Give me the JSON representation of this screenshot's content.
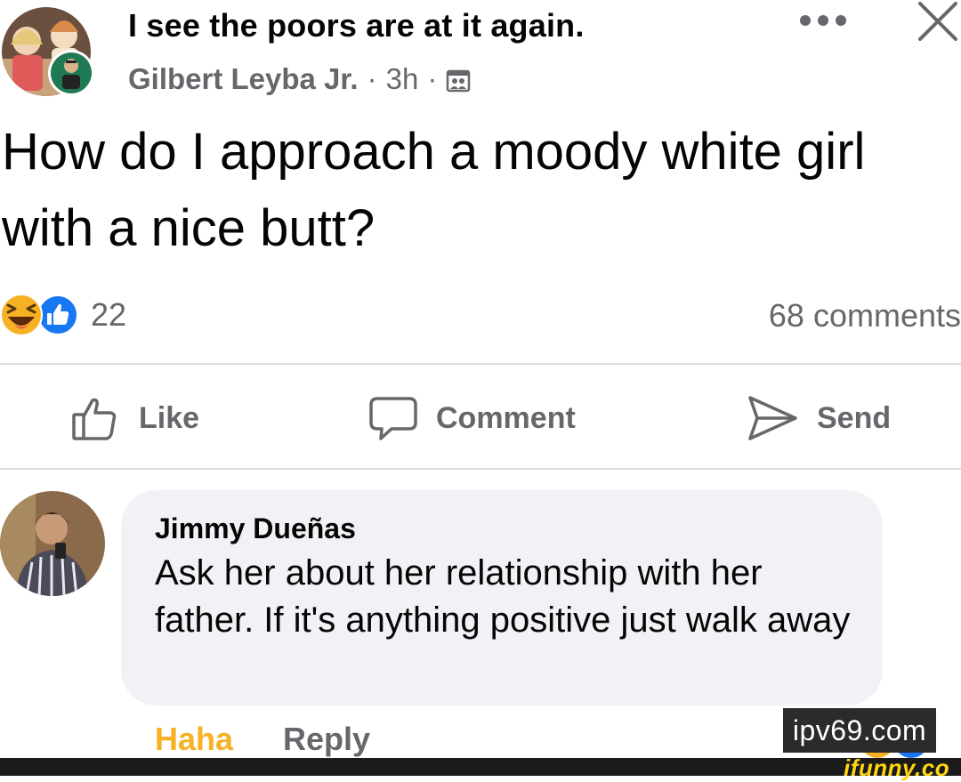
{
  "header": {
    "group_title": "I see the poors are at it again.",
    "author": "Gilbert Leyba Jr.",
    "separator": "·",
    "time": "3h",
    "icons": [
      "group-avatar",
      "more-icon",
      "close-icon",
      "audience-icon"
    ]
  },
  "post": {
    "text": "How do I approach a moody white girl with a nice butt?"
  },
  "reactions": {
    "count": "22",
    "comments_label": "68 comments",
    "icons": [
      "haha-reaction-icon",
      "like-reaction-icon"
    ]
  },
  "actions": {
    "like": "Like",
    "comment": "Comment",
    "send": "Send"
  },
  "comment": {
    "author": "Jimmy Dueñas",
    "text": "Ask her about her relationship with her father. If it's anything positive just walk away",
    "haha_label": "Haha",
    "reply_label": "Reply"
  },
  "watermarks": {
    "site": "ipv69.com",
    "brand": "ifunny.co"
  },
  "colors": {
    "secondary_text": "#65676b",
    "primary_text": "#050505",
    "bubble_bg": "#f0f2f5",
    "like_blue": "#1877f2",
    "haha_yellow": "#f7b125",
    "divider": "#dadde1"
  }
}
